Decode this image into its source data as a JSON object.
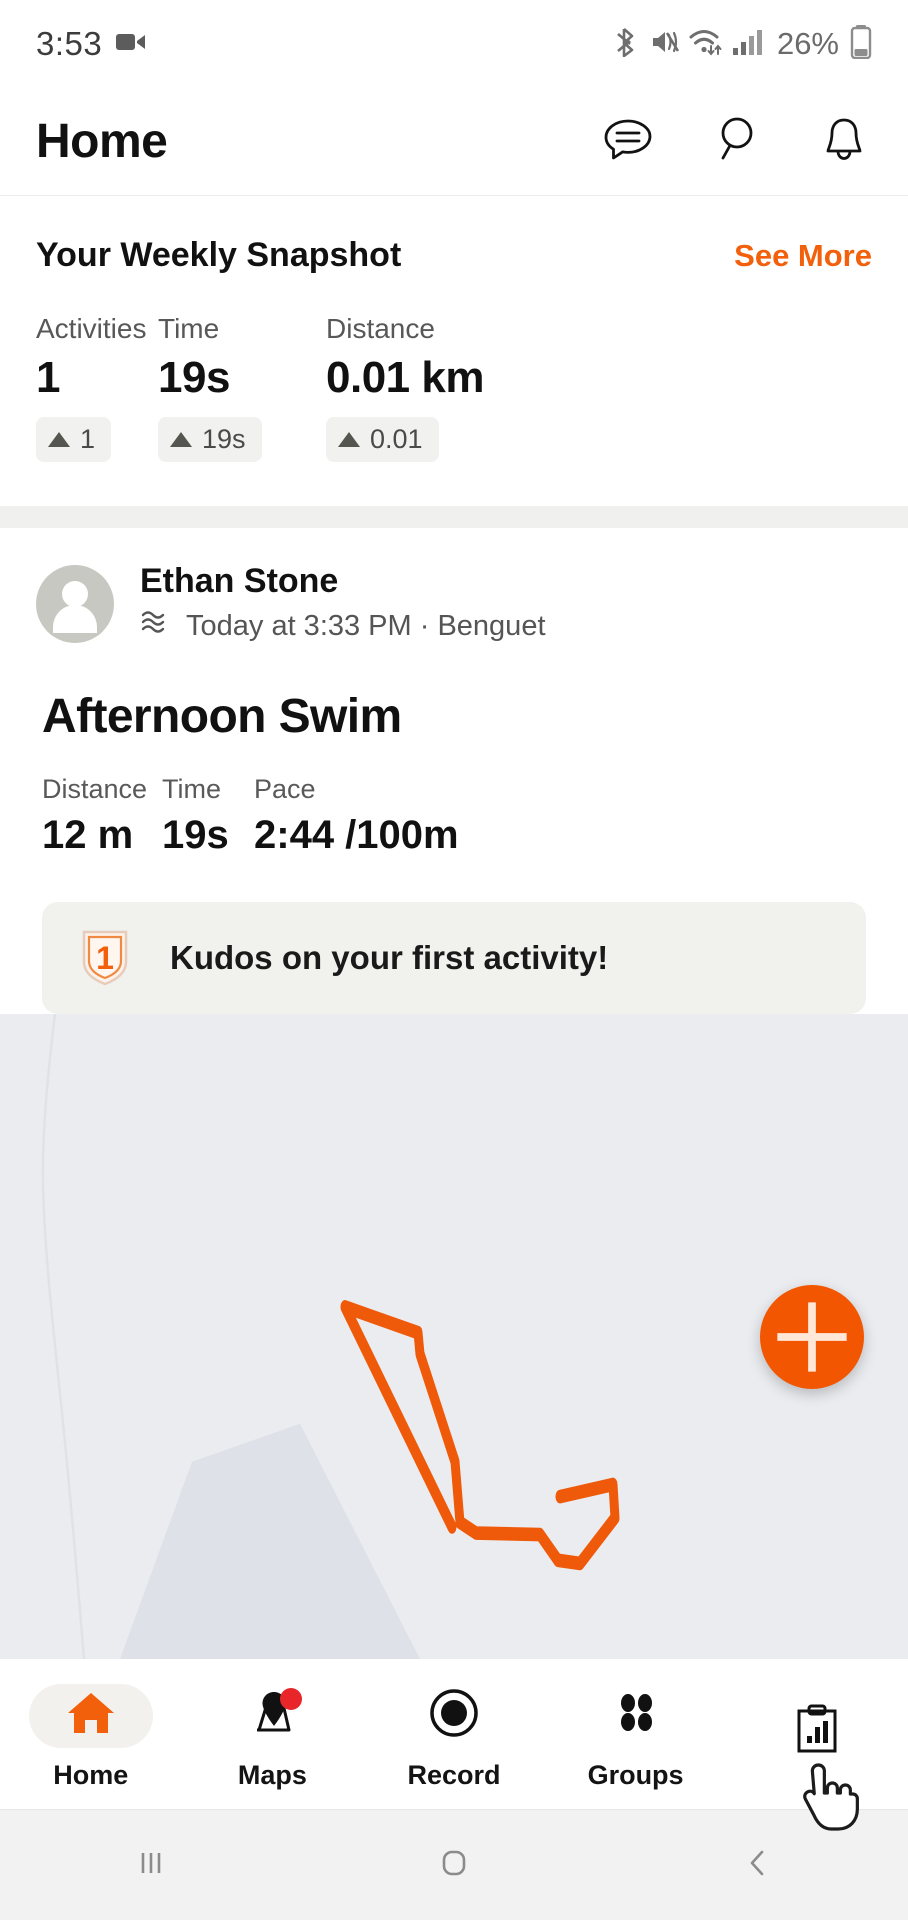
{
  "status_bar": {
    "time": "3:53",
    "battery_percent": "26%",
    "icons": [
      "screen-record-icon",
      "bluetooth-icon",
      "mute-icon",
      "wifi-icon",
      "cellular-signal-icon",
      "battery-icon"
    ]
  },
  "header": {
    "title": "Home",
    "actions": [
      {
        "name": "messages-icon",
        "label": "Messages"
      },
      {
        "name": "search-icon",
        "label": "Search"
      },
      {
        "name": "notifications-bell-icon",
        "label": "Notifications"
      }
    ]
  },
  "snapshot": {
    "title": "Your Weekly Snapshot",
    "see_more": "See More",
    "stats": [
      {
        "label": "Activities",
        "value": "1",
        "delta": "1",
        "trend": "up"
      },
      {
        "label": "Time",
        "value": "19s",
        "delta": "19s",
        "trend": "up"
      },
      {
        "label": "Distance",
        "value": "0.01 km",
        "delta": "0.01",
        "trend": "up"
      }
    ]
  },
  "activity": {
    "athlete_name": "Ethan Stone",
    "meta": "Today at 3:33 PM · Benguet",
    "sport_icon": "swim-waves-icon",
    "title": "Afternoon Swim",
    "stats": [
      {
        "label": "Distance",
        "value": "12 m"
      },
      {
        "label": "Time",
        "value": "19s"
      },
      {
        "label": "Pace",
        "value": "2:44 /100m"
      }
    ],
    "kudos": {
      "badge": "1",
      "text": "Kudos on your first activity!"
    }
  },
  "map": {
    "fab_label": "+",
    "route_color": "#ef5a0a",
    "background": "#eaecf0"
  },
  "bottom_nav": {
    "items": [
      {
        "label": "Home",
        "icon": "home-icon",
        "active": true,
        "badge": false
      },
      {
        "label": "Maps",
        "icon": "map-pin-icon",
        "active": false,
        "badge": true
      },
      {
        "label": "Record",
        "icon": "record-icon",
        "active": false,
        "badge": false
      },
      {
        "label": "Groups",
        "icon": "groups-icon",
        "active": false,
        "badge": false
      },
      {
        "label": "",
        "icon": "clipboard-chart-icon",
        "active": false,
        "badge": false
      }
    ]
  },
  "system_nav": {
    "recents": "recents-icon",
    "home": "home-square-icon",
    "back": "back-chevron-icon"
  },
  "colors": {
    "accent": "#f2600c",
    "fab": "#f25600",
    "route": "#ef5a0a",
    "badge_red": "#e8262a",
    "map_bg": "#eaecf0",
    "chip_bg": "#f1f1ef"
  }
}
